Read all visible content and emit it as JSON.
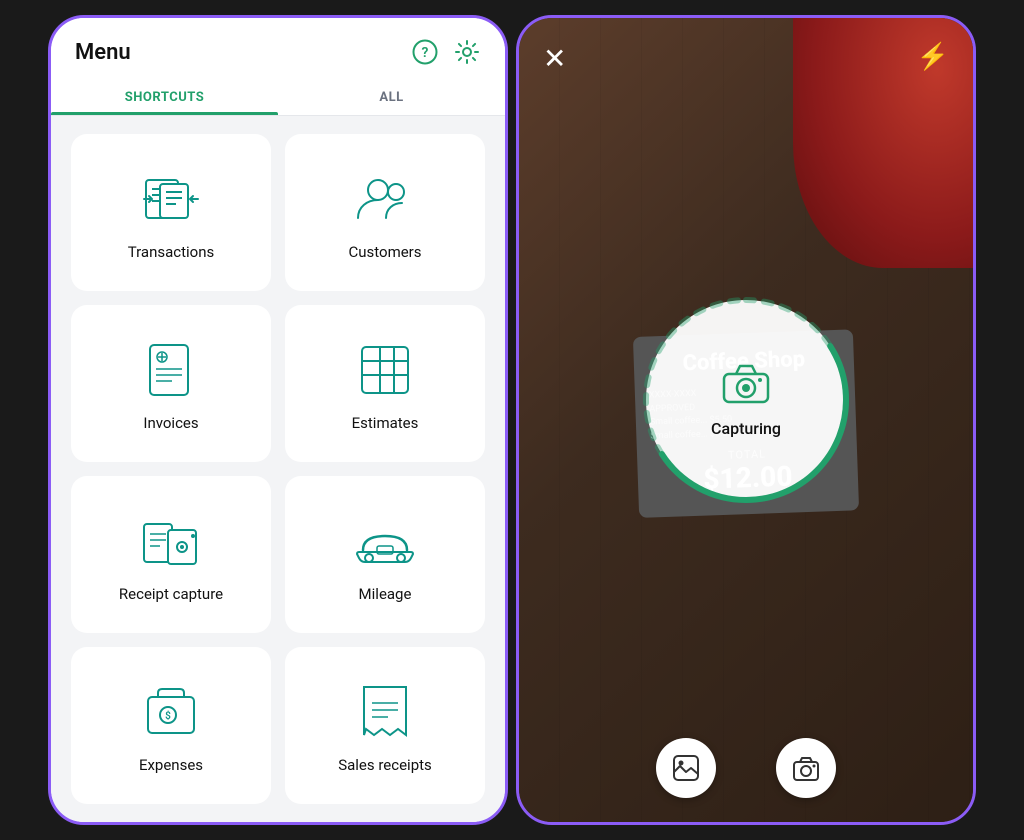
{
  "leftScreen": {
    "header": {
      "title": "Menu",
      "helpLabel": "?",
      "settingsLabel": "⚙"
    },
    "tabs": [
      {
        "id": "shortcuts",
        "label": "SHORTCUTS",
        "active": true
      },
      {
        "id": "all",
        "label": "ALL",
        "active": false
      }
    ],
    "menuItems": [
      {
        "id": "transactions",
        "label": "Transactions"
      },
      {
        "id": "customers",
        "label": "Customers"
      },
      {
        "id": "invoices",
        "label": "Invoices"
      },
      {
        "id": "estimates",
        "label": "Estimates"
      },
      {
        "id": "receipt-capture",
        "label": "Receipt capture"
      },
      {
        "id": "mileage",
        "label": "Mileage"
      },
      {
        "id": "expenses",
        "label": "Expenses"
      },
      {
        "id": "sales-receipts",
        "label": "Sales receipts"
      }
    ]
  },
  "rightScreen": {
    "closeLabel": "✕",
    "flashLabel": "⚡",
    "receipt": {
      "title": "Coffee Shop",
      "lines": [
        "XXXX-XXXX",
        "APPROVED",
        "Small coffee... $5.50",
        "Small coffee... $6.50"
      ],
      "totalLabel": "TOTAL",
      "totalAmount": "$12.00"
    },
    "capturingLabel": "Capturing",
    "bottomButtons": {
      "gallery": "🖼",
      "camera": "📷"
    }
  }
}
